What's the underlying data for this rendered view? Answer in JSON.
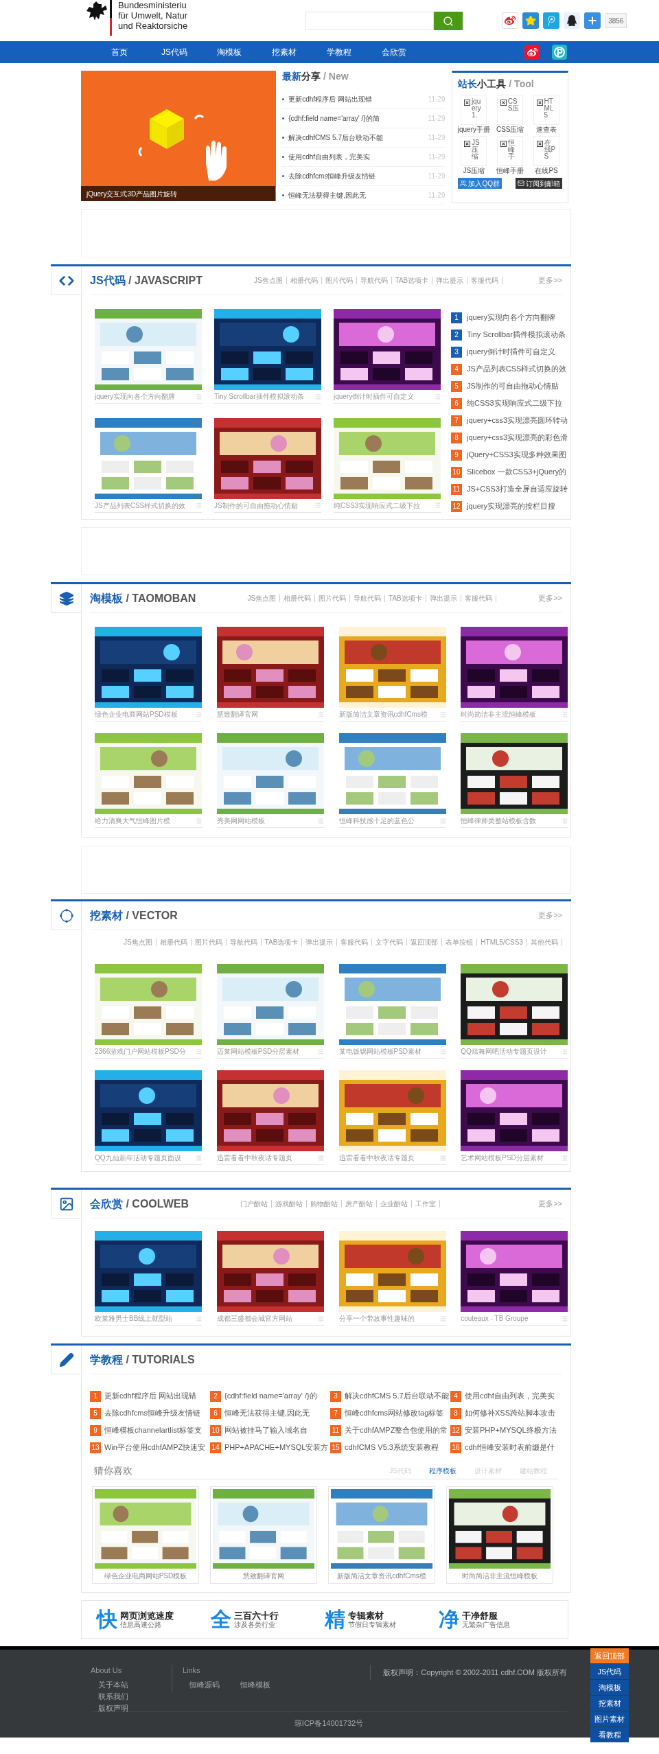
{
  "header": {
    "logo_lines": [
      "Bundesministeriu",
      "für Umwelt, Natur",
      "und Reaktorsiche"
    ],
    "share_count": "3856"
  },
  "nav": {
    "items": [
      "首页",
      "JS代码",
      "淘模板",
      "挖素材",
      "学教程",
      "会欣赏"
    ]
  },
  "banner": {
    "caption": "jQuery交互式3D产品图片旋转"
  },
  "news": {
    "title_blue": "最新",
    "title": "分享",
    "title_en": "/ New",
    "items": [
      {
        "title": "更新cdhf程序后 网站出现错",
        "date": "11-29"
      },
      {
        "title": "{cdhf:field name='array' /}的简",
        "date": "11-29"
      },
      {
        "title": "解决cdhfCMS 5.7后台联动不能",
        "date": "11-29"
      },
      {
        "title": "使用cdhf自由列表，完美实",
        "date": "11-29"
      },
      {
        "title": "去除cdhfcms恒峰升级友情链",
        "date": "11-29"
      },
      {
        "title": "恒峰无法获得主键,因此无",
        "date": "11-29"
      }
    ]
  },
  "tools": {
    "title_blue": "站长",
    "title": "小工具",
    "title_en": "/ Tool",
    "items": [
      {
        "alt": "jquery1.",
        "label": "jquery手册"
      },
      {
        "alt": "CSS压",
        "label": "CSS压缩"
      },
      {
        "alt": "HTML5",
        "label": "速查表"
      },
      {
        "alt": "JS压缩",
        "label": "JS压缩"
      },
      {
        "alt": "恒峰手",
        "label": "恒峰手册"
      },
      {
        "alt": "在线PS",
        "label": "在线PS"
      }
    ],
    "buttons": [
      {
        "kind": "qq",
        "label": "加入QQ群"
      },
      {
        "kind": "mail",
        "label": "订阅到邮箱"
      }
    ]
  },
  "sections": [
    {
      "kind": "js",
      "title": "JS代码",
      "title_en": "/ JAVASCRIPT",
      "more": "更多>>",
      "tags": [
        "JS焦点图",
        "相册代码",
        "图片代码",
        "导航代码",
        "TAB选项卡",
        "弹出提示",
        "客服代码"
      ],
      "cards": [
        {
          "title": "jquery实现向各个方向翻牌"
        },
        {
          "title": "Tiny Scrollbar插件模拟滚动条"
        },
        {
          "title": "jquery倒计时插件可自定义"
        },
        {
          "title": "JS产品列表CSS样式切换的效"
        },
        {
          "title": "JS制作的可自由拖动心情贴"
        },
        {
          "title": "纯CSS3实现响应式二级下拉"
        }
      ],
      "list": [
        {
          "num": "1",
          "title": "jquery实现向各个方向翻牌",
          "color": "#1a5fb4"
        },
        {
          "num": "2",
          "title": "Tiny Scrollbar插件模拟滚动条",
          "color": "#1a5fb4"
        },
        {
          "num": "3",
          "title": "jquery倒计时插件可自定义",
          "color": "#1a5fb4"
        },
        {
          "num": "4",
          "title": "JS产品列表CSS样式切换的效",
          "color": "#f26522"
        },
        {
          "num": "5",
          "title": "JS制作的可自由拖动心情贴",
          "color": "#f26522"
        },
        {
          "num": "6",
          "title": "纯CSS3实现响应式二级下拉",
          "color": "#f26522"
        },
        {
          "num": "7",
          "title": "jquery+css3实现漂亮圆环转动",
          "color": "#f26522"
        },
        {
          "num": "8",
          "title": "jquery+css3实现漂亮的彩色滑",
          "color": "#f26522"
        },
        {
          "num": "9",
          "title": "jQuery+CSS3实现多种效果图",
          "color": "#f26522"
        },
        {
          "num": "10",
          "title": "Slicebox 一款CSS3+jQuery的",
          "color": "#f26522"
        },
        {
          "num": "11",
          "title": "JS+CSS3打造全屏自适应旋转",
          "color": "#f26522"
        },
        {
          "num": "12",
          "title": "jquery实现漂亮的按栏目搜",
          "color": "#f26522"
        }
      ]
    },
    {
      "kind": "template",
      "title": "淘模板",
      "title_en": "/ TAOMOBAN",
      "more": "更多>>",
      "tags": [
        "JS焦点图",
        "相册代码",
        "图片代码",
        "导航代码",
        "TAB选项卡",
        "弹出提示",
        "客服代码"
      ],
      "cards": [
        {
          "title": "绿色企业电商网站PSD模板"
        },
        {
          "title": "慧致翻译官网"
        },
        {
          "title": "新版简洁文章资讯cdhfCms模"
        },
        {
          "title": "时尚简洁非主流恒峰模板"
        },
        {
          "title": "给力清爽大气恒峰图片模"
        },
        {
          "title": "秀美网网站模板"
        },
        {
          "title": "恒峰科技感十足的蓝色公"
        },
        {
          "title": "恒峰律师类整站模板含数"
        }
      ]
    },
    {
      "kind": "vector",
      "title": "挖素材",
      "title_en": "/ VECTOR",
      "more": "更多>>",
      "tags": [
        "JS焦点图",
        "相册代码",
        "图片代码",
        "导航代码",
        "TAB选项卡",
        "弹出提示",
        "客服代码",
        "文字代码",
        "返回顶部",
        "表单按钮",
        "HTML5/CSS3",
        "其他代码"
      ],
      "cards": [
        {
          "title": "2366游戏门户网站模板PSD分"
        },
        {
          "title": "迈莱网站模板PSD分层素材"
        },
        {
          "title": "某电饭锅网站模板PSD素材"
        },
        {
          "title": "QQ炫舞网吧活动专题页设计"
        },
        {
          "title": "QQ九仙新年活动专题页面设"
        },
        {
          "title": "迅雷看看中秋夜话专题页"
        },
        {
          "title": "迅雷看看中秋夜话专题页"
        },
        {
          "title": "艺术网站模板PSD分层素材"
        }
      ]
    },
    {
      "kind": "gallery",
      "title": "会欣赏",
      "title_en": "/ COOLWEB",
      "more": "更多>>",
      "tags": [
        "门户酷站",
        "游戏酷站",
        "购物酷站",
        "房产酷站",
        "企业酷站",
        "工作室"
      ],
      "cards": [
        {
          "title": "欧莱雅男士BB线上就型站"
        },
        {
          "title": "成都三盛都会城官方网站"
        },
        {
          "title": "分享一个带故事性趣味的"
        },
        {
          "title": "couteaux - TB Groupe"
        }
      ]
    }
  ],
  "tutorials": {
    "title": "学教程",
    "title_en": "/ TUTORIALS",
    "items": [
      {
        "num": "1",
        "title": "更新cdhf程序后 网站出现错"
      },
      {
        "num": "2",
        "title": "{cdhf:field name='array' /}的"
      },
      {
        "num": "3",
        "title": "解决cdhfCMS 5.7后台联动不能"
      },
      {
        "num": "4",
        "title": "使用cdhf自由列表，完美实"
      },
      {
        "num": "5",
        "title": "去除cdhfcms恒峰升级友情链"
      },
      {
        "num": "6",
        "title": "恒峰无法获得主键,因此无"
      },
      {
        "num": "7",
        "title": "恒峰cdhfcms网站修改tag标签"
      },
      {
        "num": "8",
        "title": "如何修补XSS跨站脚本攻击"
      },
      {
        "num": "9",
        "title": "恒峰模板channelartlist标签支"
      },
      {
        "num": "10",
        "title": "网站被挂马了输入域名自"
      },
      {
        "num": "11",
        "title": "关于cdhfAMPZ整合包使用的常"
      },
      {
        "num": "12",
        "title": "安装PHP+MYSQL终极方法"
      },
      {
        "num": "13",
        "title": "Win平台使用cdhfAMPZ快速安"
      },
      {
        "num": "14",
        "title": "PHP+APACHE+MYSQL安装方"
      },
      {
        "num": "15",
        "title": "cdhfCMS V5.3系统安装教程"
      },
      {
        "num": "16",
        "title": "cdhf恒峰安装时表前缀是什"
      }
    ],
    "guess": {
      "title": "猜你喜欢",
      "tabs": [
        {
          "label": "JS代码",
          "selected": false
        },
        {
          "label": "程序模板",
          "selected": true
        },
        {
          "label": "设计素材",
          "selected": false
        },
        {
          "label": "建站教程",
          "selected": false
        }
      ],
      "cards": [
        {
          "title": "绿色企业电商网站PSD模板"
        },
        {
          "title": "慧致翻译官网"
        },
        {
          "title": "新版简洁文章资讯cdhfCms模"
        },
        {
          "title": "时尚简洁非主流恒峰模板"
        }
      ]
    }
  },
  "features": [
    {
      "char": "快",
      "title": "网页浏览速度",
      "subtitle": "信息高速公路"
    },
    {
      "char": "全",
      "title": "三百六十行",
      "subtitle": "涉及各类行业"
    },
    {
      "char": "精",
      "title": "专辑素材",
      "subtitle": "节假日专辑素材"
    },
    {
      "char": "净",
      "title": "干净舒服",
      "subtitle": "无繁杂广告信息"
    }
  ],
  "footer": {
    "about": {
      "title": "About Us",
      "links": [
        "关于本站",
        "联系我们",
        "版权声明"
      ]
    },
    "links": {
      "title": "Links",
      "links": [
        "恒峰源码",
        "恒峰模板"
      ]
    },
    "copyright": "版权声明：Copyright © 2002-2011 cdhf.COM 版权所有",
    "icp": "琼ICP备14001732号"
  },
  "side_menu": [
    {
      "kind": "top",
      "label": "返回顶部"
    },
    {
      "kind": "nav",
      "label": "JS代码"
    },
    {
      "kind": "nav",
      "label": "淘模板"
    },
    {
      "kind": "nav",
      "label": "挖素材"
    },
    {
      "kind": "nav",
      "label": "图片素材"
    },
    {
      "kind": "nav",
      "label": "看教程"
    }
  ]
}
